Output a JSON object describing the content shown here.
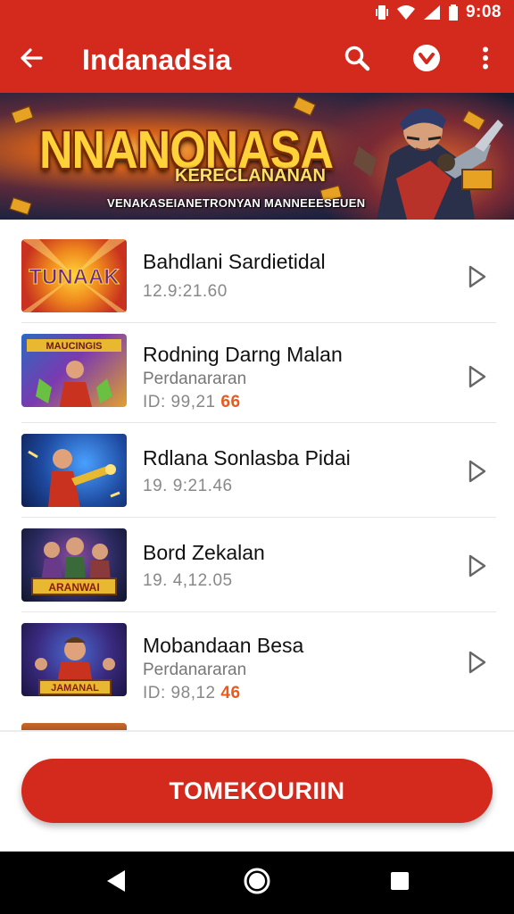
{
  "status_bar": {
    "time": "9:08"
  },
  "app_bar": {
    "title": "Indanadsia",
    "back_icon": "arrow-back-icon",
    "search_icon": "search-icon",
    "badge_icon": "chevron-badge-icon",
    "more_icon": "more-vert-icon"
  },
  "banner": {
    "title": "NNANONASA",
    "subtitle": "KERECLANANAN",
    "tagline": "VENAKASEIANETRONYAN MANNEEESEUEN"
  },
  "list": {
    "items": [
      {
        "title": "Bahdlani Sardietidal",
        "subtitle": "",
        "meta": "12.9:21.60",
        "price": "",
        "thumb_icon": "game-thumbnail-1"
      },
      {
        "title": "Rodning Darng Malan",
        "subtitle": "Perdanararan",
        "meta": "ID: 99,21",
        "price": "66",
        "thumb_icon": "game-thumbnail-2"
      },
      {
        "title": "Rdlana Sonlasba Pidai",
        "subtitle": "",
        "meta": "19. 9:21.46",
        "price": "",
        "thumb_icon": "game-thumbnail-3"
      },
      {
        "title": "Bord Zekalan",
        "subtitle": "",
        "meta": "19. 4,12.05",
        "price": "",
        "thumb_icon": "game-thumbnail-4"
      },
      {
        "title": "Mobandaan Besa",
        "subtitle": "Perdanararan",
        "meta": "ID: 98,12",
        "price": "46",
        "thumb_icon": "game-thumbnail-5"
      }
    ]
  },
  "primary_button": {
    "label": "TOMEKOURIIN"
  },
  "nav_bar": {
    "back_icon": "nav-back-icon",
    "home_icon": "nav-home-icon",
    "recents_icon": "nav-recents-icon"
  },
  "colors": {
    "brand_red": "#d42a1e",
    "price_orange": "#e85a1e"
  }
}
